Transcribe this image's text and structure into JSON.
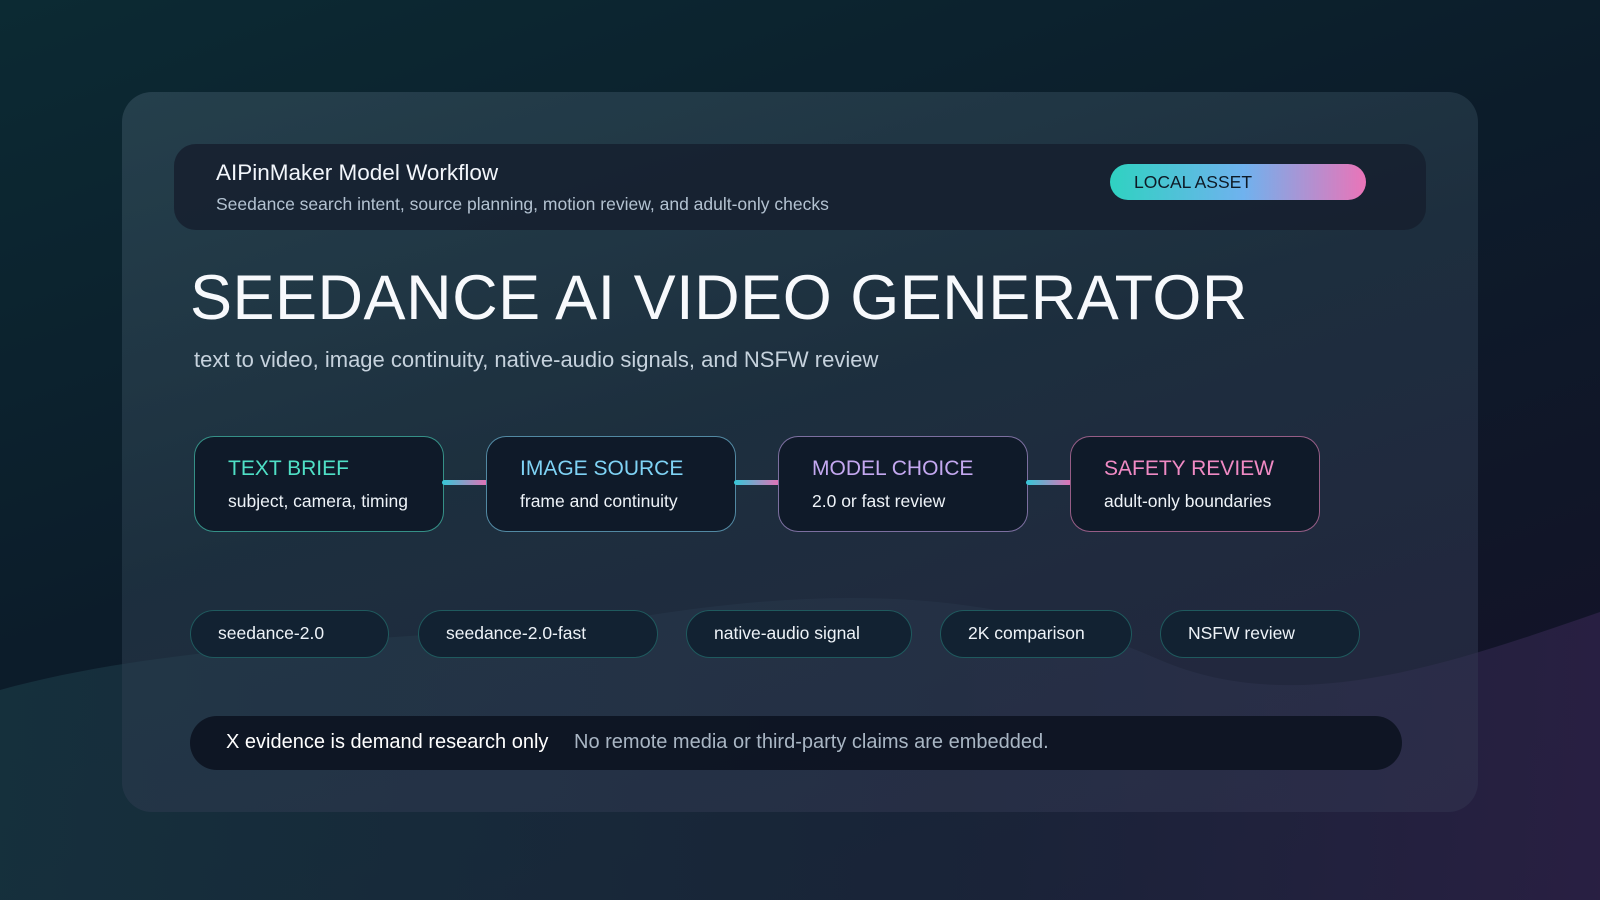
{
  "header": {
    "title": "AIPinMaker Model Workflow",
    "subtitle": "Seedance search intent, source planning, motion review, and adult-only checks",
    "badge": "LOCAL ASSET"
  },
  "hero": {
    "title": "SEEDANCE AI VIDEO GENERATOR",
    "subtitle": "text to video, image continuity, native-audio signals, and NSFW review"
  },
  "steps": [
    {
      "label": "TEXT BRIEF",
      "desc": "subject, camera, timing",
      "color": "#4fe0c6"
    },
    {
      "label": "IMAGE SOURCE",
      "desc": "frame and continuity",
      "color": "#7fd3f5"
    },
    {
      "label": "MODEL CHOICE",
      "desc": "2.0 or fast review",
      "color": "#c4a8f0"
    },
    {
      "label": "SAFETY REVIEW",
      "desc": "adult-only boundaries",
      "color": "#f08ac4"
    }
  ],
  "tags": [
    "seedance-2.0",
    "seedance-2.0-fast",
    "native-audio signal",
    "2K comparison",
    "NSFW review"
  ],
  "footer": {
    "strong": "X evidence is demand research only",
    "note": "No remote media or third-party claims are embedded."
  }
}
